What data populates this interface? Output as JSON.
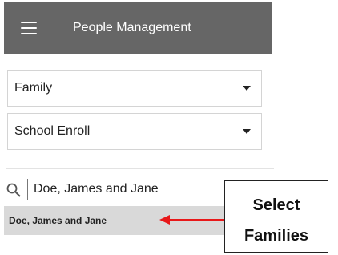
{
  "header": {
    "title": "People Management",
    "menu_icon": "hamburger-menu-icon"
  },
  "filters": {
    "type_select": {
      "value": "Family"
    },
    "form_select": {
      "value": "School Enroll"
    }
  },
  "search": {
    "icon": "search-icon",
    "value": "Doe, James and Jane"
  },
  "results": [
    {
      "label": "Doe, James and Jane"
    }
  ],
  "callout": {
    "line1": "Select",
    "line2": "Families",
    "arrow_color": "#e8181a"
  },
  "colors": {
    "header_bg": "#666666",
    "selected_row_bg": "#d9d9d9"
  }
}
